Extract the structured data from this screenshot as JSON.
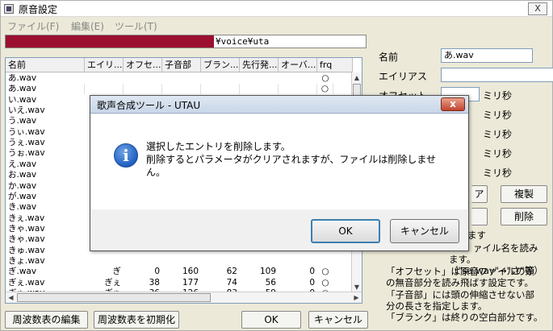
{
  "window": {
    "title": "原音設定",
    "close_label": "X"
  },
  "menu": [
    {
      "label": "ファイル(F)"
    },
    {
      "label": "編集(E)"
    },
    {
      "label": "ツール(T)"
    }
  ],
  "path": {
    "visible_suffix": "¥voice¥uta"
  },
  "list": {
    "headers": [
      "名前",
      "エイリ...",
      "オフセ...",
      "子音部",
      "ブラン...",
      "先行発...",
      "オーバ...",
      "frq"
    ],
    "rows": [
      {
        "name": "あ.wav",
        "alias": "",
        "offset": "",
        "consonant": "",
        "blank": "",
        "preutter": "",
        "overlap": "",
        "frq": "○"
      },
      {
        "name": "あ.wav",
        "alias": "",
        "offset": "",
        "consonant": "",
        "blank": "",
        "preutter": "",
        "overlap": "",
        "frq": "○"
      },
      {
        "name": "い.wav",
        "alias": "",
        "offset": "",
        "consonant": "",
        "blank": "",
        "preutter": "",
        "overlap": "",
        "frq": "○"
      },
      {
        "name": "いえ.wav",
        "alias": "",
        "offset": "",
        "consonant": "",
        "blank": "",
        "preutter": "",
        "overlap": "",
        "frq": ""
      },
      {
        "name": "う.wav",
        "alias": "",
        "offset": "",
        "consonant": "",
        "blank": "",
        "preutter": "",
        "overlap": "",
        "frq": ""
      },
      {
        "name": "うぃ.wav",
        "alias": "",
        "offset": "",
        "consonant": "",
        "blank": "",
        "preutter": "",
        "overlap": "",
        "frq": ""
      },
      {
        "name": "うぇ.wav",
        "alias": "",
        "offset": "",
        "consonant": "",
        "blank": "",
        "preutter": "",
        "overlap": "",
        "frq": ""
      },
      {
        "name": "うぉ.wav",
        "alias": "",
        "offset": "",
        "consonant": "",
        "blank": "",
        "preutter": "",
        "overlap": "",
        "frq": ""
      },
      {
        "name": "え.wav",
        "alias": "",
        "offset": "",
        "consonant": "",
        "blank": "",
        "preutter": "",
        "overlap": "",
        "frq": ""
      },
      {
        "name": "お.wav",
        "alias": "",
        "offset": "",
        "consonant": "",
        "blank": "",
        "preutter": "",
        "overlap": "",
        "frq": ""
      },
      {
        "name": "か.wav",
        "alias": "",
        "offset": "",
        "consonant": "",
        "blank": "",
        "preutter": "",
        "overlap": "",
        "frq": ""
      },
      {
        "name": "が.wav",
        "alias": "",
        "offset": "",
        "consonant": "",
        "blank": "",
        "preutter": "",
        "overlap": "",
        "frq": ""
      },
      {
        "name": "き.wav",
        "alias": "",
        "offset": "",
        "consonant": "",
        "blank": "",
        "preutter": "",
        "overlap": "",
        "frq": ""
      },
      {
        "name": "きぇ.wav",
        "alias": "",
        "offset": "",
        "consonant": "",
        "blank": "",
        "preutter": "",
        "overlap": "",
        "frq": ""
      },
      {
        "name": "きゃ.wav",
        "alias": "",
        "offset": "",
        "consonant": "",
        "blank": "",
        "preutter": "",
        "overlap": "",
        "frq": ""
      },
      {
        "name": "きゃ.wav",
        "alias": "",
        "offset": "",
        "consonant": "",
        "blank": "",
        "preutter": "",
        "overlap": "",
        "frq": ""
      },
      {
        "name": "きゅ.wav",
        "alias": "",
        "offset": "",
        "consonant": "",
        "blank": "",
        "preutter": "",
        "overlap": "",
        "frq": ""
      },
      {
        "name": "きょ.wav",
        "alias": "",
        "offset": "",
        "consonant": "",
        "blank": "",
        "preutter": "",
        "overlap": "",
        "frq": ""
      },
      {
        "name": "ぎ.wav",
        "alias": "ぎ",
        "offset": "0",
        "consonant": "160",
        "blank": "62",
        "preutter": "109",
        "overlap": "0",
        "frq": "○"
      },
      {
        "name": "ぎぇ.wav",
        "alias": "ぎぇ",
        "offset": "38",
        "consonant": "177",
        "blank": "74",
        "preutter": "56",
        "overlap": "0",
        "frq": "○"
      },
      {
        "name": "ぎゃ.wav",
        "alias": "ぎゃ",
        "offset": "36",
        "consonant": "126",
        "blank": "83",
        "preutter": "59",
        "overlap": "0",
        "frq": "○"
      }
    ]
  },
  "fields": {
    "name_label": "名前",
    "name_value": "あ.wav",
    "alias_label": "エイリアス",
    "alias_value": "",
    "offset_label": "オフセット",
    "unit": "ミリ秒"
  },
  "buttons": {
    "apply_partial": "ア",
    "duplicate": "複製",
    "delete": "削除",
    "edit_freq": "周波数表の編集",
    "init_freq": "周波数表を初期化",
    "ok": "OK",
    "cancel": "キャンセル"
  },
  "help": {
    "line0": "されます",
    "line1": "ァイル名を読み",
    "line2": "ます。（\"sa.wav\"→\"さ\"等）",
    "line3": "「オフセット」は原音ファイルの頭",
    "line4": "の無音部分を読み飛ばす設定です。",
    "line5": "「子音部」には頭の伸縮させない部",
    "line6": "分の長さを指定します。",
    "line7": "「ブランク」は終りの空白部分です。"
  },
  "dialog": {
    "title": "歌声合成ツール - UTAU",
    "close_label": "x",
    "message_line1": "選択したエントリを削除します。",
    "message_line2": "削除するとパラメータがクリアされますが、ファイルは削除しませ",
    "message_line3": "ん。",
    "ok": "OK",
    "cancel": "キャンセル"
  }
}
